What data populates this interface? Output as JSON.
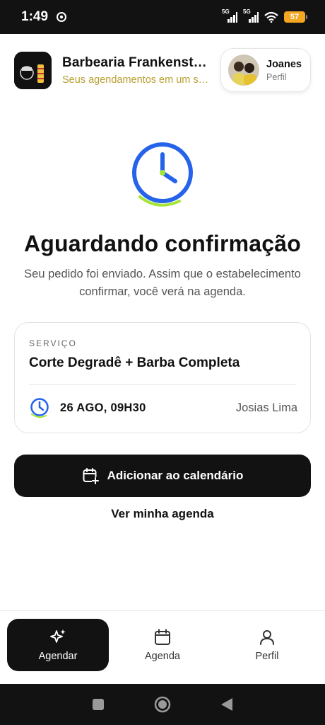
{
  "status_bar": {
    "time": "1:49",
    "signal1_label": "5G",
    "signal2_label": "5G",
    "battery": "57"
  },
  "header": {
    "shop_name": "Barbearia Frankenstein",
    "shop_subtitle": "Seus agendamentos em um só lugar",
    "profile_name": "Joanes",
    "profile_label": "Perfil"
  },
  "main": {
    "title": "Aguardando confirmação",
    "subtitle": "Seu pedido foi enviado. Assim que o estabelecimento confirmar, você verá na agenda.",
    "card": {
      "label": "SERVIÇO",
      "service": "Corte Degradê + Barba Completa",
      "datetime": "26 AGO, 09H30",
      "barber": "Josias Lima"
    },
    "primary_button": "Adicionar ao calendário",
    "secondary_link": "Ver minha agenda"
  },
  "bottom_nav": {
    "items": [
      {
        "label": "Agendar",
        "icon": "sparkle-icon"
      },
      {
        "label": "Agenda",
        "icon": "calendar-icon"
      },
      {
        "label": "Perfil",
        "icon": "user-icon"
      }
    ]
  },
  "colors": {
    "accent_blue": "#2563eb",
    "accent_green": "#a3e635",
    "subtitle_gold": "#b8a032",
    "dark": "#121212"
  }
}
